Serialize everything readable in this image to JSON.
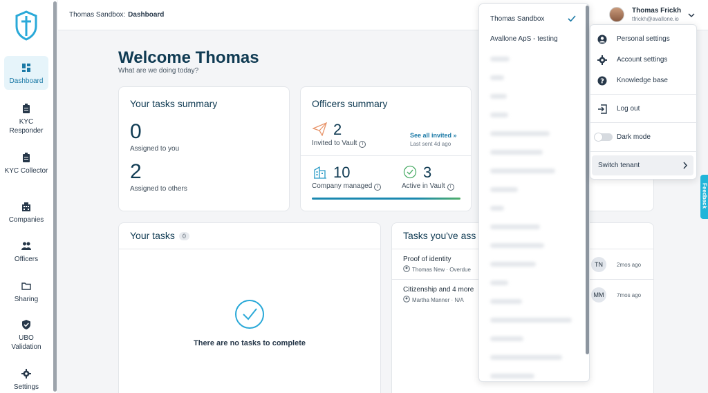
{
  "breadcrumb": {
    "tenant": "Thomas Sandbox:",
    "page": "Dashboard"
  },
  "user": {
    "name": "Thomas Frickh",
    "email": "tfrickh@avallone.io"
  },
  "sidebar": {
    "items": [
      {
        "label": "Dashboard",
        "icon": "dashboard-icon"
      },
      {
        "label": "KYC Responder",
        "icon": "clipboard-icon"
      },
      {
        "label": "KYC Collector",
        "icon": "clipboard-icon"
      },
      {
        "label": "Companies",
        "icon": "building-icon"
      },
      {
        "label": "Officers",
        "icon": "people-icon"
      },
      {
        "label": "Sharing",
        "icon": "folder-icon"
      },
      {
        "label": "UBO Validation",
        "icon": "shield-check-icon"
      },
      {
        "label": "Settings",
        "icon": "gear-icon"
      }
    ]
  },
  "welcome": {
    "title": "Welcome Thomas",
    "subtitle": "What are we doing today?"
  },
  "tasks_summary": {
    "title": "Your tasks summary",
    "assigned_to_you": "0",
    "assigned_to_you_label": "Assigned to you",
    "assigned_to_others": "2",
    "assigned_to_others_label": "Assigned to others"
  },
  "officers_summary": {
    "title": "Officers summary",
    "invited": "2",
    "invited_label": "Invited to Vault",
    "see_all": "See all invited »",
    "last_sent": "Last sent 4d ago",
    "company_managed": "10",
    "company_managed_label": "Company managed",
    "active": "3",
    "active_label": "Active in Vault"
  },
  "your_tasks": {
    "title": "Your tasks",
    "count": "0",
    "empty": "There are no tasks to complete"
  },
  "assigned_tasks": {
    "title": "Tasks you've ass",
    "rows": [
      {
        "title": "Proof of identity",
        "meta": "Thomas New · Overdue",
        "initials": "TN",
        "time": "2mos ago"
      },
      {
        "title": "Citizenship and 4 more",
        "meta": "Martha Manner · N/A",
        "initials": "MM",
        "time": "7mos ago"
      }
    ]
  },
  "tenant_dropdown": {
    "items": [
      "Thomas Sandbox",
      "Avallone ApS - testing"
    ],
    "selected": "Thomas Sandbox"
  },
  "user_menu": {
    "personal": "Personal settings",
    "account": "Account settings",
    "knowledge": "Knowledge base",
    "logout": "Log out",
    "dark_mode": "Dark mode",
    "switch_tenant": "Switch tenant"
  },
  "feedback": "Feedback",
  "colors": {
    "accent": "#1a79a6",
    "title": "#103b53",
    "feedback": "#22b5d9"
  }
}
